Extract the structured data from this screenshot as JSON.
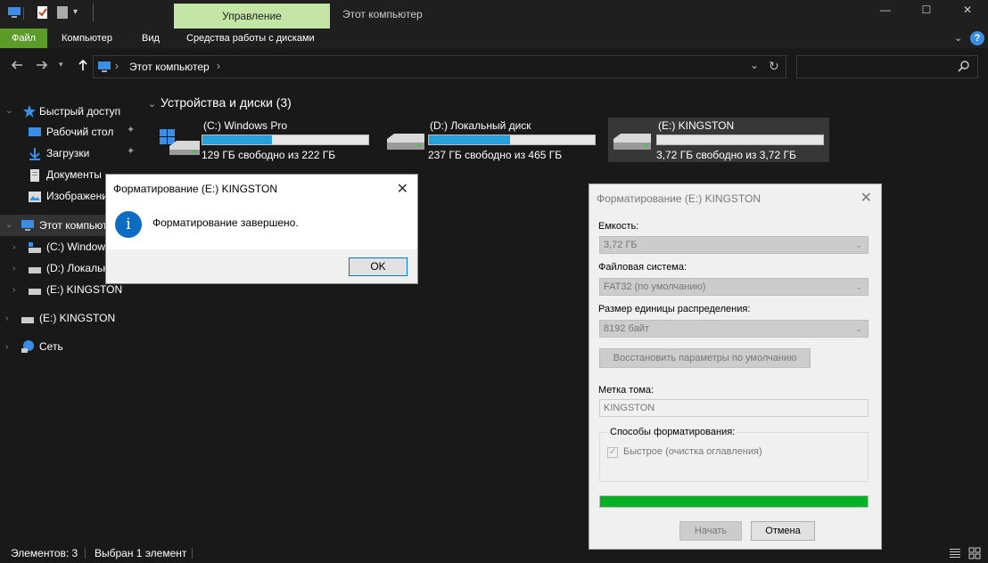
{
  "titlebar": {
    "manage_tab": "Управление",
    "window_title": "Этот компьютер",
    "controls": {
      "minimize": "—",
      "maximize": "☐",
      "close": "✕"
    }
  },
  "ribbon": {
    "file": "Файл",
    "computer": "Компьютер",
    "view": "Вид",
    "disk_tools": "Средства работы с дисками",
    "collapse": "⌄",
    "help": "?"
  },
  "address": {
    "path": "Этот компьютер",
    "chevron": "›",
    "dropdown": "⌄",
    "refresh": "↻",
    "search_icon": "⌕"
  },
  "sidebar": {
    "quick_access": "Быстрый доступ",
    "desktop": "Рабочий стол",
    "downloads": "Загрузки",
    "documents": "Документы",
    "pictures": "Изображени",
    "this_pc": "Этот компьютер",
    "drive_c": "(C:) Windows Pro",
    "drive_d": "(D:) Локальный диск",
    "drive_e": "(E:) KINGSTON",
    "drive_e2": "(E:) KINGSTON",
    "network": "Сеть"
  },
  "main": {
    "section_title": "Устройства и диски (3)",
    "drives": [
      {
        "name": "(C:) Windows Pro",
        "free": "129 ГБ свободно из 222 ГБ",
        "used_fraction": 0.42
      },
      {
        "name": "(D:) Локальный диск",
        "free": "237 ГБ свободно из 465 ГБ",
        "used_fraction": 0.49
      },
      {
        "name": "(E:) KINGSTON",
        "free": "3,72 ГБ свободно из 3,72 ГБ",
        "used_fraction": 0.0
      }
    ]
  },
  "statusbar": {
    "items": "Элементов: 3",
    "selected": "Выбран 1 элемент"
  },
  "message_box": {
    "title": "Форматирование (E:) KINGSTON",
    "text": "Форматирование завершено.",
    "ok": "OK",
    "icon": "i"
  },
  "format_dialog": {
    "title": "Форматирование (E:) KINGSTON",
    "capacity_label": "Емкость:",
    "capacity_value": "3,72 ГБ",
    "fs_label": "Файловая система:",
    "fs_value": "FAT32 (по умолчанию)",
    "unit_label": "Размер единицы распределения:",
    "unit_value": "8192 байт",
    "restore_button": "Восстановить параметры по умолчанию",
    "volume_label": "Метка тома:",
    "volume_value": "KINGSTON",
    "methods_label": "Способы форматирования:",
    "quick_format": "Быстрое (очистка оглавления)",
    "progress_fraction": 1.0,
    "start_button": "Начать",
    "cancel_button": "Отмена"
  },
  "colors": {
    "accent_green": "#5b9b2a",
    "manage_tab": "#c3e6a6",
    "drive_bar": "#26a0da",
    "progress": "#06b025"
  }
}
